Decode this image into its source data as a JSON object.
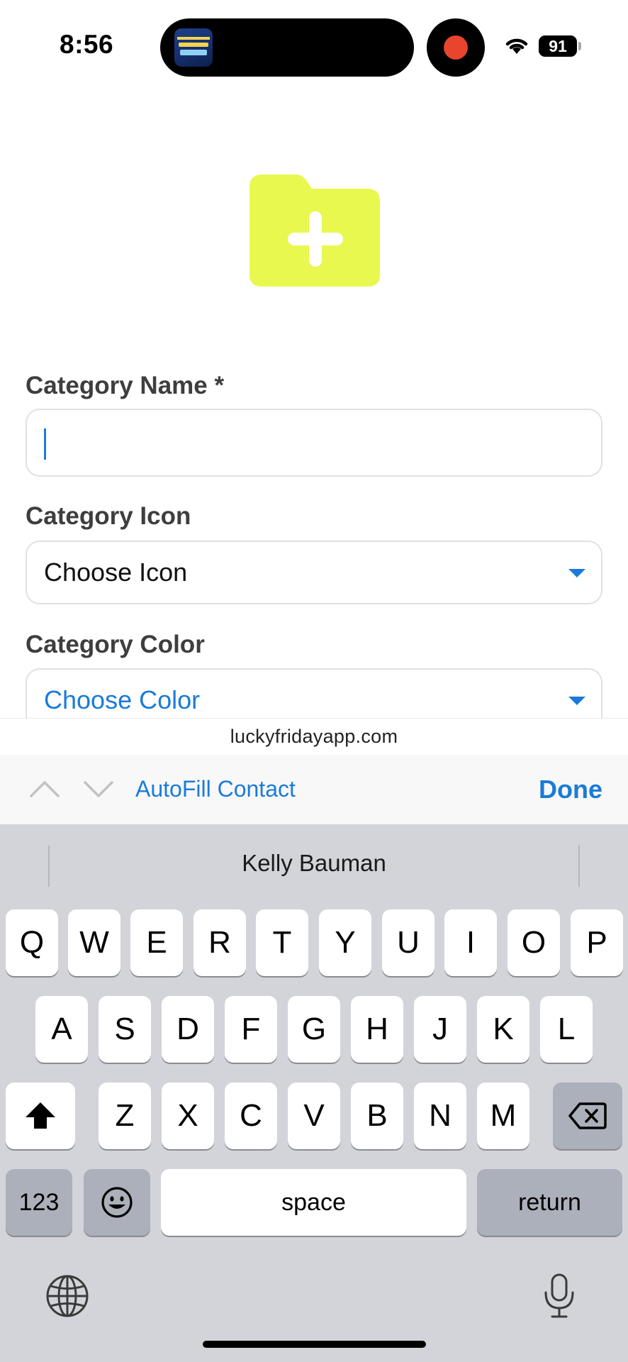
{
  "status_bar": {
    "time": "8:56",
    "battery": "91"
  },
  "form": {
    "name_label": "Category Name *",
    "name_value": "",
    "icon_label": "Category Icon",
    "icon_value": "Choose Icon",
    "color_label": "Category Color",
    "color_value": "Choose Color"
  },
  "url": "luckyfridayapp.com",
  "toolbar": {
    "autofill": "AutoFill Contact",
    "done": "Done"
  },
  "keyboard": {
    "suggestion": "Kelly Bauman",
    "row1": [
      "Q",
      "W",
      "E",
      "R",
      "T",
      "Y",
      "U",
      "I",
      "O",
      "P"
    ],
    "row2": [
      "A",
      "S",
      "D",
      "F",
      "G",
      "H",
      "J",
      "K",
      "L"
    ],
    "row3": [
      "Z",
      "X",
      "C",
      "V",
      "B",
      "N",
      "M"
    ],
    "numbers": "123",
    "space": "space",
    "return": "return"
  },
  "colors": {
    "accent": "#1a7bd9",
    "folder": "#e8f84f",
    "label": "#3e3e3e"
  }
}
